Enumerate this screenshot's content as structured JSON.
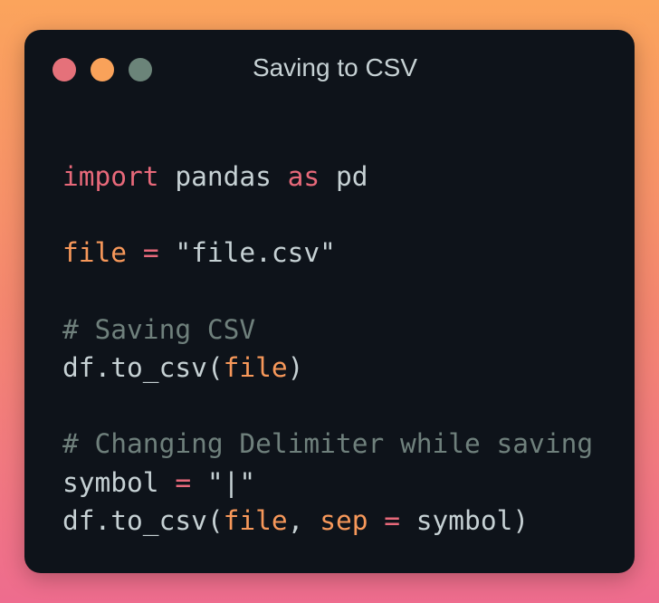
{
  "window": {
    "title": "Saving to CSV",
    "controls": [
      {
        "name": "close",
        "color": "#e5717a"
      },
      {
        "name": "minimize",
        "color": "#f9a25a"
      },
      {
        "name": "maximize",
        "color": "#6b8479"
      }
    ]
  },
  "code": {
    "language": "python",
    "lines": [
      [
        {
          "t": "keyword",
          "v": "import"
        },
        {
          "t": "plain",
          "v": " pandas "
        },
        {
          "t": "keyword",
          "v": "as"
        },
        {
          "t": "plain",
          "v": " pd"
        }
      ],
      [],
      [
        {
          "t": "var",
          "v": "file"
        },
        {
          "t": "plain",
          "v": " "
        },
        {
          "t": "op",
          "v": "="
        },
        {
          "t": "plain",
          "v": " \"file.csv\""
        }
      ],
      [],
      [
        {
          "t": "comment",
          "v": "# Saving CSV"
        }
      ],
      [
        {
          "t": "plain",
          "v": "df.to_csv("
        },
        {
          "t": "var",
          "v": "file"
        },
        {
          "t": "plain",
          "v": ")"
        }
      ],
      [],
      [
        {
          "t": "comment",
          "v": "# Changing Delimiter while saving"
        }
      ],
      [
        {
          "t": "plain",
          "v": "symbol "
        },
        {
          "t": "op",
          "v": "="
        },
        {
          "t": "plain",
          "v": " \"|\""
        }
      ],
      [
        {
          "t": "plain",
          "v": "df.to_csv("
        },
        {
          "t": "var",
          "v": "file"
        },
        {
          "t": "plain",
          "v": ", "
        },
        {
          "t": "var",
          "v": "sep"
        },
        {
          "t": "plain",
          "v": " "
        },
        {
          "t": "op",
          "v": "="
        },
        {
          "t": "plain",
          "v": " symbol)"
        }
      ]
    ]
  }
}
